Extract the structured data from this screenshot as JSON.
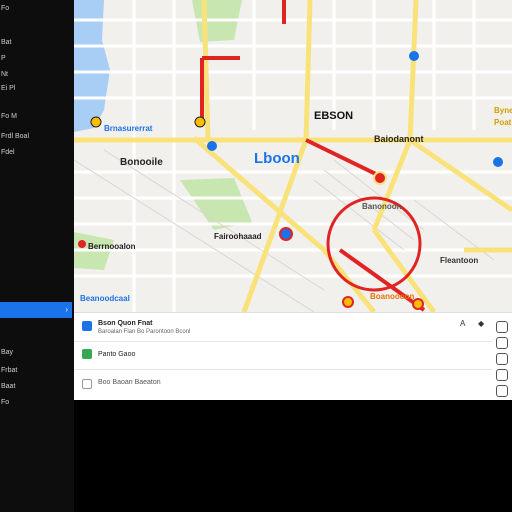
{
  "sidebar": {
    "items": [
      {
        "label": "Fo"
      },
      {
        "label": "Bat"
      },
      {
        "label": "P"
      },
      {
        "label": "Nt"
      },
      {
        "label": "Ei Pl"
      },
      {
        "label": "Fo M"
      },
      {
        "label": "Frdl Boal"
      },
      {
        "label": "Fdel"
      },
      {
        "label": "Bay"
      },
      {
        "label": "Frbat"
      },
      {
        "label": "Baat"
      },
      {
        "label": "Fo"
      }
    ],
    "active_chevron": "›"
  },
  "map": {
    "labels": {
      "center": "Lboon",
      "top": "EBSON",
      "blvd": "Baiodanont",
      "street1": "Bonooile",
      "street2": "Brnasurerrat",
      "street3": "Fairoohaaad",
      "street4": "Beanoodcaal",
      "street5": "Banonoon",
      "street6": "Fleantoon",
      "street7": "Berrnooalon",
      "street8": "Boanoooon",
      "right1": "Byne",
      "right2": "Poat"
    },
    "colors": {
      "water": "#a8cef5",
      "park": "#c8e6b0",
      "major_road": "#f9e27a",
      "route": "#e02424",
      "background": "#f2f0ec"
    }
  },
  "panel": {
    "rows": [
      {
        "title": "Bson Quon Fnat",
        "subtitle": "Baroalan Flan Bo Parontoon Bconl",
        "icon": "pin-icon",
        "icon_color": "#1a73e8"
      },
      {
        "title": "Panto Gaoo",
        "subtitle": "",
        "icon": "green-square-icon",
        "icon_color": "#34a853"
      },
      {
        "title": "Boo Baoan Baeaton",
        "subtitle": "",
        "icon": "info-icon",
        "icon_color": "#777777"
      }
    ],
    "actions": [
      "A",
      "◆"
    ]
  }
}
